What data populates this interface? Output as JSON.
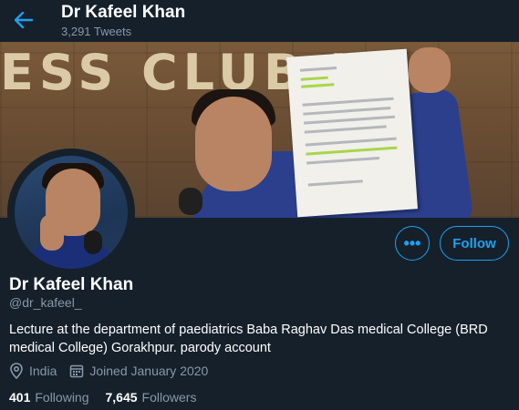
{
  "header": {
    "title": "Dr Kafeel Khan",
    "tweet_count": "3,291 Tweets"
  },
  "banner": {
    "wall_text": "ESS CLUB IN"
  },
  "actions": {
    "more_label": "•••",
    "follow_label": "Follow"
  },
  "profile": {
    "name": "Dr Kafeel Khan",
    "handle": "@dr_kafeel_",
    "bio": "Lecture at the department of paediatrics Baba Raghav Das medical College (BRD medical College)  Gorakhpur. parody account",
    "location": "India",
    "joined": "Joined January 2020"
  },
  "stats": {
    "following_count": "401",
    "following_label": "Following",
    "followers_count": "7,645",
    "followers_label": "Followers"
  },
  "colors": {
    "background": "#15202b",
    "accent": "#1da1f2",
    "muted_text": "#8899a6"
  },
  "icons": {
    "back": "arrow-left-icon",
    "location": "map-pin-icon",
    "calendar": "calendar-icon"
  }
}
